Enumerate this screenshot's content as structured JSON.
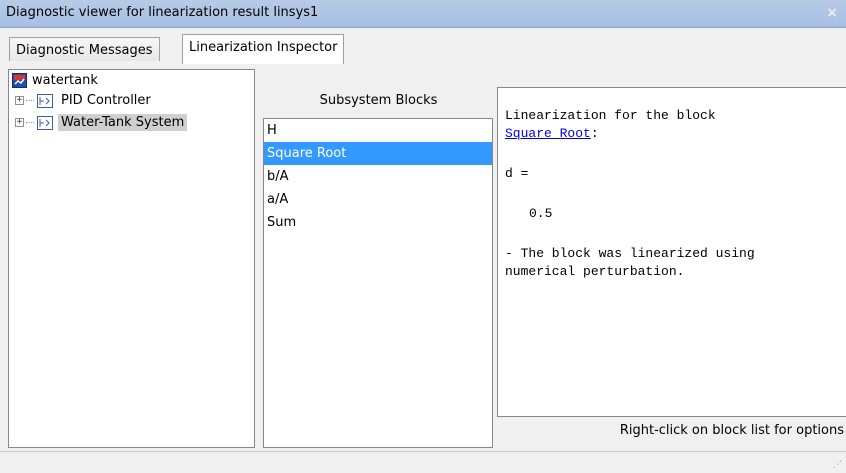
{
  "window": {
    "title": "Diagnostic viewer for linearization result linsys1",
    "close_glyph": "×"
  },
  "tabs": [
    {
      "label": "Diagnostic Messages",
      "active": false
    },
    {
      "label": "Linearization Inspector",
      "active": true
    }
  ],
  "tree": {
    "root": {
      "label": "watertank",
      "icon": "simulink-model-icon"
    },
    "children": [
      {
        "label": "PID Controller",
        "icon": "subsystem-block-icon",
        "expander": "+",
        "selected": false
      },
      {
        "label": "Water-Tank System",
        "icon": "subsystem-block-icon",
        "expander": "+",
        "selected": true
      }
    ]
  },
  "blocks": {
    "header": "Subsystem Blocks",
    "items": [
      "H",
      "Square Root",
      "b/A",
      "a/A",
      "Sum"
    ],
    "selected": "Square Root"
  },
  "info": {
    "line1": "Linearization for the block",
    "link": "Square Root",
    "link_suffix": ":",
    "d_label": "d =",
    "d_value": "0.5",
    "note_line1": "- The block was linearized using",
    "note_line2": "numerical perturbation."
  },
  "hint": "Right-click on block list for options",
  "colors": {
    "titlebar": "#a6bfe2",
    "selection": "#3399ff",
    "tree_selection": "#cfcfcf",
    "link": "#0000ee"
  }
}
